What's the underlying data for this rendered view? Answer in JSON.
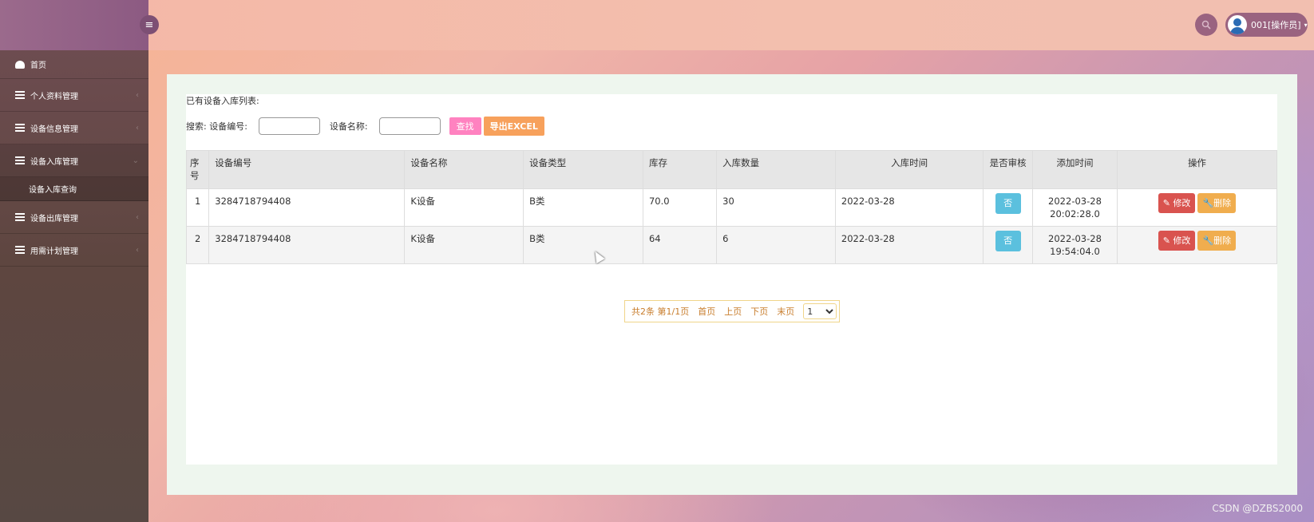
{
  "topbar": {
    "user_label": "001[操作员]"
  },
  "sidebar": {
    "items": [
      {
        "label": "首页",
        "icon": "dashboard-icon"
      },
      {
        "label": "个人资料管理",
        "icon": "list-icon"
      },
      {
        "label": "设备信息管理",
        "icon": "list-icon"
      },
      {
        "label": "设备入库管理",
        "icon": "list-icon"
      },
      {
        "label": "设备出库管理",
        "icon": "list-icon"
      },
      {
        "label": "用需计划管理",
        "icon": "list-icon"
      }
    ],
    "sub_item": "设备入库查询"
  },
  "main": {
    "list_title": "已有设备入库列表:",
    "search_prefix": "搜索: 设备编号:",
    "search_name_label": "设备名称:",
    "search_code_value": "",
    "search_name_value": "",
    "find_button": "查找",
    "export_button": "导出EXCEL",
    "table": {
      "headers": [
        "序号",
        "设备编号",
        "设备名称",
        "设备类型",
        "库存",
        "入库数量",
        "入库时间",
        "是否审核",
        "添加时间",
        "操作"
      ],
      "rows": [
        {
          "no": "1",
          "code": "3284718794408",
          "name": "K设备",
          "type": "B类",
          "stock": "70.0",
          "qty": "30",
          "in_time": "2022-03-28",
          "audit": "否",
          "add_date": "2022-03-28",
          "add_time": "20:02:28.0"
        },
        {
          "no": "2",
          "code": "3284718794408",
          "name": "K设备",
          "type": "B类",
          "stock": "64",
          "qty": "6",
          "in_time": "2022-03-28",
          "audit": "否",
          "add_date": "2022-03-28",
          "add_time": "19:54:04.0"
        }
      ],
      "edit_label": "修改",
      "delete_label": "删除"
    },
    "pager": {
      "summary": "共2条 第1/1页",
      "first": "首页",
      "prev": "上页",
      "next": "下页",
      "last": "末页",
      "page_select": "1"
    }
  },
  "watermark": "CSDN @DZBS2000",
  "colors": {
    "sidebar": "#5e4640",
    "find_button": "#ff82c0",
    "export_button": "#f7a15c",
    "edit_button": "#d9534f",
    "delete_button": "#f0ad4e",
    "audit_pill": "#5bc0de"
  }
}
